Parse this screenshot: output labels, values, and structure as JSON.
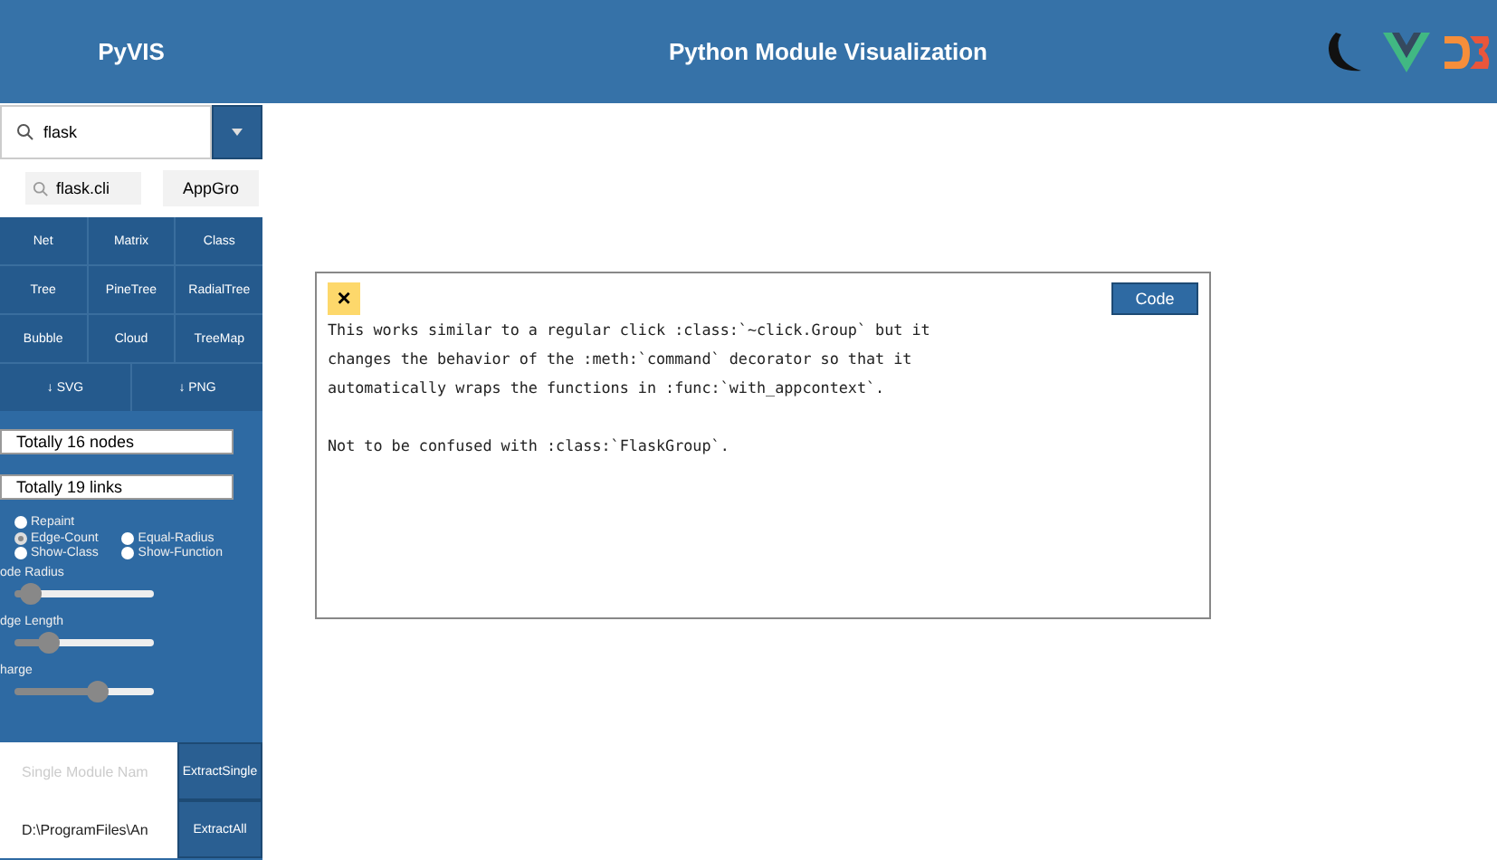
{
  "header": {
    "brand": "PyVIS",
    "title": "Python Module Visualization"
  },
  "sidebar": {
    "search": {
      "value": "flask"
    },
    "module_search": {
      "value": "flask.cli"
    },
    "module_button": "AppGro",
    "views": [
      "Net",
      "Matrix",
      "Class",
      "Tree",
      "PineTree",
      "RadialTree",
      "Bubble",
      "Cloud",
      "TreeMap"
    ],
    "exports": [
      {
        "icon": "↓",
        "label": "SVG"
      },
      {
        "icon": "↓",
        "label": "PNG"
      }
    ],
    "stats": [
      "Totally 16 nodes",
      "Totally 19 links"
    ],
    "options": [
      {
        "label": "Repaint",
        "checked": false
      },
      {
        "label": "Edge-Count",
        "checked": true
      },
      {
        "label": "Equal-Radius",
        "checked": false
      },
      {
        "label": "Show-Class",
        "checked": false
      },
      {
        "label": "Show-Function",
        "checked": false
      }
    ],
    "sliders": [
      {
        "label": "ode Radius",
        "level": 0.12
      },
      {
        "label": "dge Length",
        "level": 0.25
      },
      {
        "label": "harge",
        "level": 0.6
      }
    ],
    "extract": [
      {
        "placeholder": "Single Module Nam",
        "button": "ExtractSingle"
      },
      {
        "value": "D:\\ProgramFiles\\An",
        "button": "ExtractAll"
      }
    ]
  },
  "modal": {
    "close": "×",
    "button": "Code",
    "paragraphs": [
      "This works similar to a regular click :class:`~click.Group` but it\nchanges the behavior of the :meth:`command` decorator so that it\nautomatically wraps the functions in :func:`with_appcontext`.",
      "Not to be confused with :class:`FlaskGroup`."
    ]
  }
}
